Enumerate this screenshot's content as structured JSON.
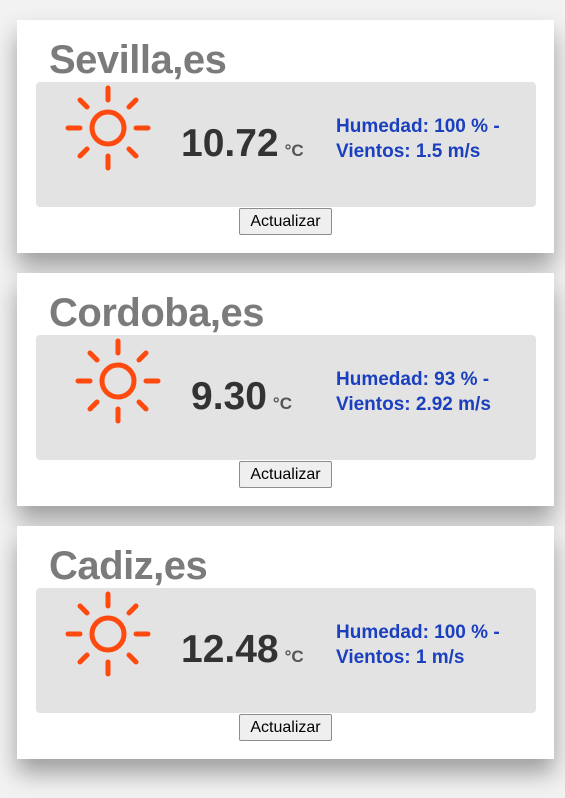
{
  "colors": {
    "sun": "#ff4a0f",
    "city_text": "#7b7b7b",
    "info_text": "#1a3fbf",
    "panel_bg": "#e3e3e3"
  },
  "cards": [
    {
      "city": "Sevilla,es",
      "icon": "sun-icon",
      "temperature": "10.72",
      "unit": "°C",
      "humidity_line": "Humedad: 100 % -",
      "wind_line": "Vientos: 1.5 m/s",
      "button_label": "Actualizar"
    },
    {
      "city": "Cordoba,es",
      "icon": "sun-icon",
      "temperature": "9.30",
      "unit": "°C",
      "humidity_line": "Humedad: 93 % -",
      "wind_line": "Vientos: 2.92 m/s",
      "button_label": "Actualizar"
    },
    {
      "city": "Cadiz,es",
      "icon": "sun-icon",
      "temperature": "12.48",
      "unit": "°C",
      "humidity_line": "Humedad: 100 % -",
      "wind_line": "Vientos: 1 m/s",
      "button_label": "Actualizar"
    }
  ]
}
